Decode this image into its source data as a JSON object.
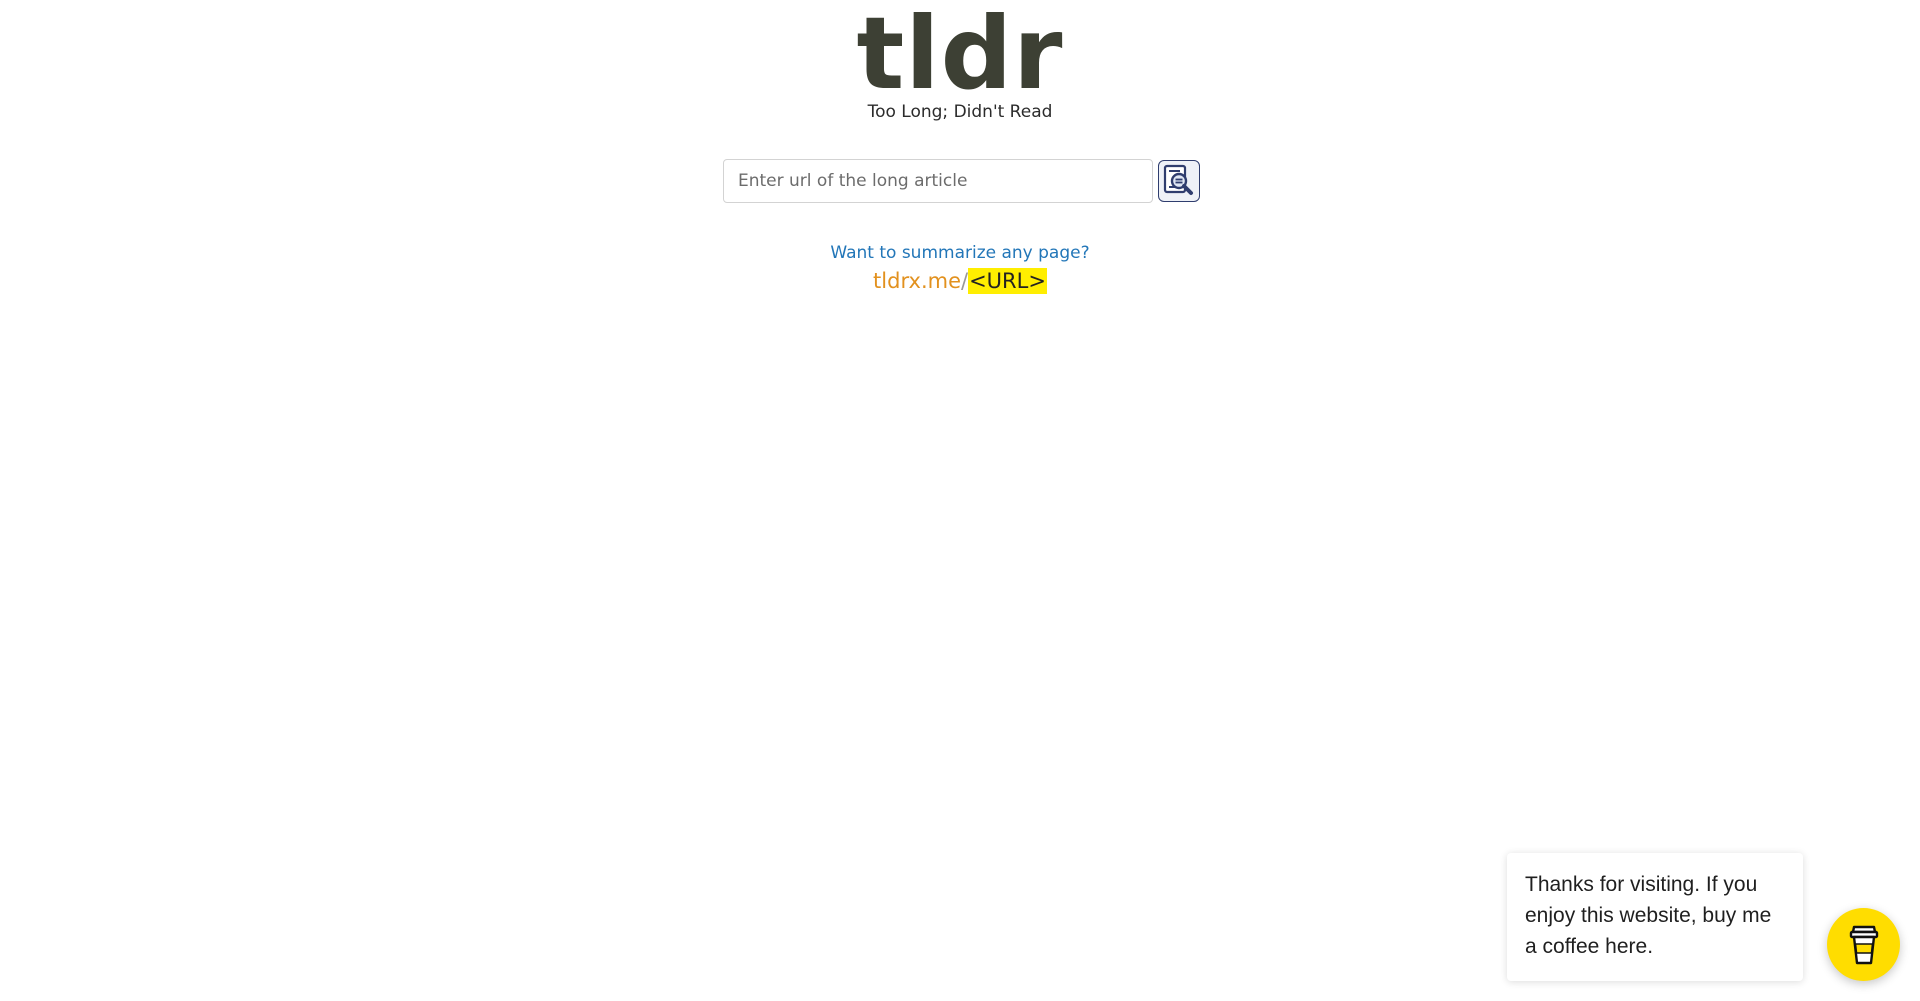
{
  "header": {
    "logo": "tldr",
    "tagline": "Too Long; Didn't Read"
  },
  "search": {
    "placeholder": "Enter url of the long article",
    "value": "",
    "button_icon": "document-search-icon"
  },
  "promo": {
    "question": "Want to summarize any page?",
    "domain": "tldrx.me",
    "slash": "/",
    "placeholder": "<URL>"
  },
  "coffee": {
    "message": "Thanks for visiting. If you enjoy this website, buy me a coffee here.",
    "icon": "coffee-cup-icon"
  },
  "colors": {
    "logo": "#3d4034",
    "link": "#2276b8",
    "domain": "#e2911e",
    "highlight": "#ffee00",
    "coffee_button": "#ffdd00",
    "search_icon": "#2f3d6e"
  }
}
